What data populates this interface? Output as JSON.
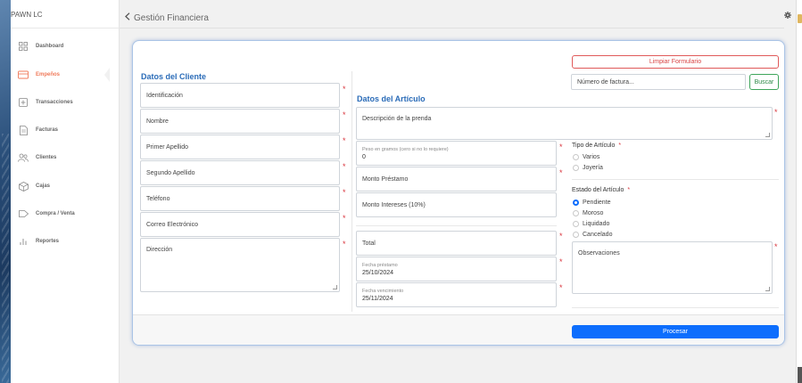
{
  "app": {
    "brand": "PAWN LC"
  },
  "sidebar": {
    "items": [
      {
        "label": "Dashboard",
        "icon": "dashboard-grid-icon",
        "active": false
      },
      {
        "label": "Empeños",
        "icon": "card-icon",
        "active": true
      },
      {
        "label": "Transacciones",
        "icon": "plus-square-icon",
        "active": false
      },
      {
        "label": "Facturas",
        "icon": "document-icon",
        "active": false
      },
      {
        "label": "Clientes",
        "icon": "users-icon",
        "active": false
      },
      {
        "label": "Cajas",
        "icon": "box-icon",
        "active": false
      },
      {
        "label": "Compra / Venta",
        "icon": "tag-icon",
        "active": false
      },
      {
        "label": "Reportes",
        "icon": "bar-chart-icon",
        "active": false
      }
    ]
  },
  "header": {
    "title": "Gestión Financiera",
    "back_icon": "chevron-left-icon",
    "settings_icon": "gear-icon"
  },
  "colors": {
    "accent": "#0d6efd",
    "active_nav": "#f07a5a",
    "section_title": "#2b6cb8",
    "required": "#d9363e"
  },
  "form": {
    "clear_button": "Limpiar Formulario",
    "invoice_search": {
      "placeholder": "Número de factura...",
      "button": "Buscar"
    },
    "cliente": {
      "title": "Datos del Cliente",
      "fields": {
        "identificacion": "Identificación",
        "nombre": "Nombre",
        "primer_apellido": "Primer Apellido",
        "segundo_apellido": "Segundo Apellido",
        "telefono": "Teléfono",
        "correo": "Correo Electrónico",
        "direccion": "Dirección"
      }
    },
    "articulo": {
      "title": "Datos del Artículo",
      "descripcion": "Descripción de la prenda",
      "peso": {
        "label": "Peso en gramos (cero si no lo requiere)",
        "value": "0"
      },
      "monto_prestamo": "Monto Préstamo",
      "monto_intereses": "Monto Intereses (10%)",
      "total": "Total",
      "fecha_prestamo": {
        "label": "Fecha préstamo",
        "value": "25/10/2024"
      },
      "fecha_vencimiento": {
        "label": "Fecha vencimiento",
        "value": "25/11/2024"
      },
      "tipo": {
        "label": "Tipo de Artículo",
        "options": [
          "Varios",
          "Joyería"
        ],
        "selected": null
      },
      "estado": {
        "label": "Estado del Artículo",
        "options": [
          "Pendiente",
          "Moroso",
          "Liquidado",
          "Cancelado"
        ],
        "selected": "Pendiente"
      },
      "observaciones": "Observaciones"
    },
    "submit_button": "Procesar"
  }
}
